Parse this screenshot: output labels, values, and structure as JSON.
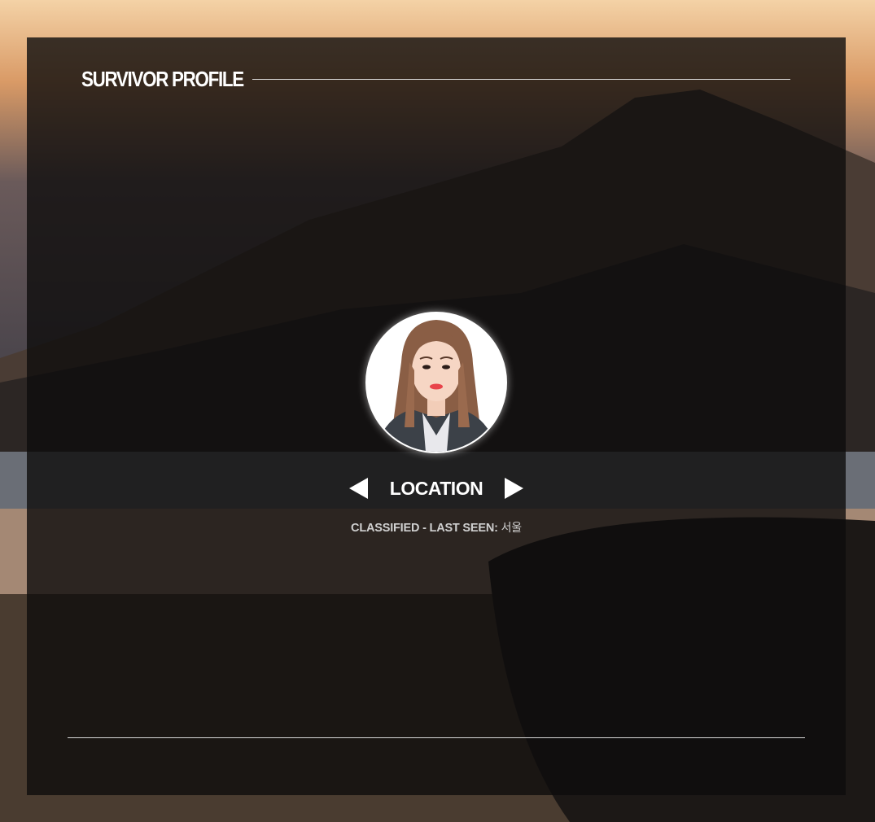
{
  "profile": {
    "title": "SURVIVOR PROFILE",
    "avatar_alt": "",
    "location_label": "LOCATION",
    "status_prefix": "CLASSIFIED - LAST SEEN: ",
    "status_value": "서울"
  },
  "colors": {
    "text": "#ffffff",
    "muted_text": "#d0d0d0",
    "line": "#d8d8d8",
    "panel": "#0e0c0c"
  },
  "icons": {
    "prev": "arrow-left-icon",
    "next": "arrow-right-icon"
  }
}
